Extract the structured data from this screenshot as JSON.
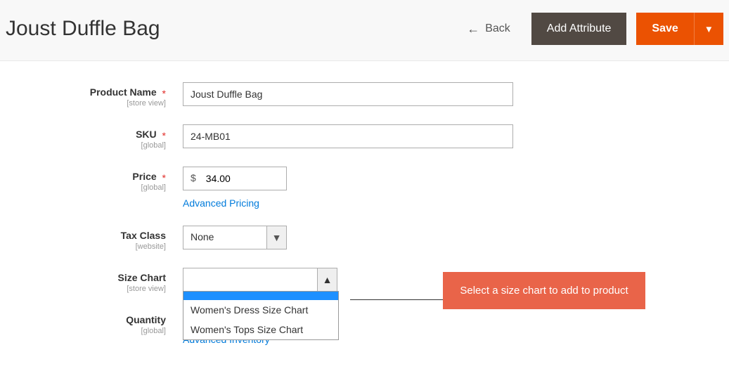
{
  "header": {
    "title": "Joust Duffle Bag",
    "back_label": "Back",
    "add_attribute_label": "Add Attribute",
    "save_label": "Save"
  },
  "fields": {
    "product_name": {
      "label": "Product Name",
      "scope": "[store view]",
      "value": "Joust Duffle Bag"
    },
    "sku": {
      "label": "SKU",
      "scope": "[global]",
      "value": "24-MB01"
    },
    "price": {
      "label": "Price",
      "scope": "[global]",
      "currency": "$",
      "value": "34.00",
      "advanced_link": "Advanced Pricing"
    },
    "tax_class": {
      "label": "Tax Class",
      "scope": "[website]",
      "value": "None"
    },
    "size_chart": {
      "label": "Size Chart",
      "scope": "[store view]",
      "value": "",
      "options": [
        "",
        "Women's Dress Size Chart",
        "Women's Tops Size Chart"
      ]
    },
    "quantity": {
      "label": "Quantity",
      "scope": "[global]",
      "advanced_link": "Advanced Inventory"
    }
  },
  "callout": {
    "text": "Select a size chart to add to product"
  }
}
